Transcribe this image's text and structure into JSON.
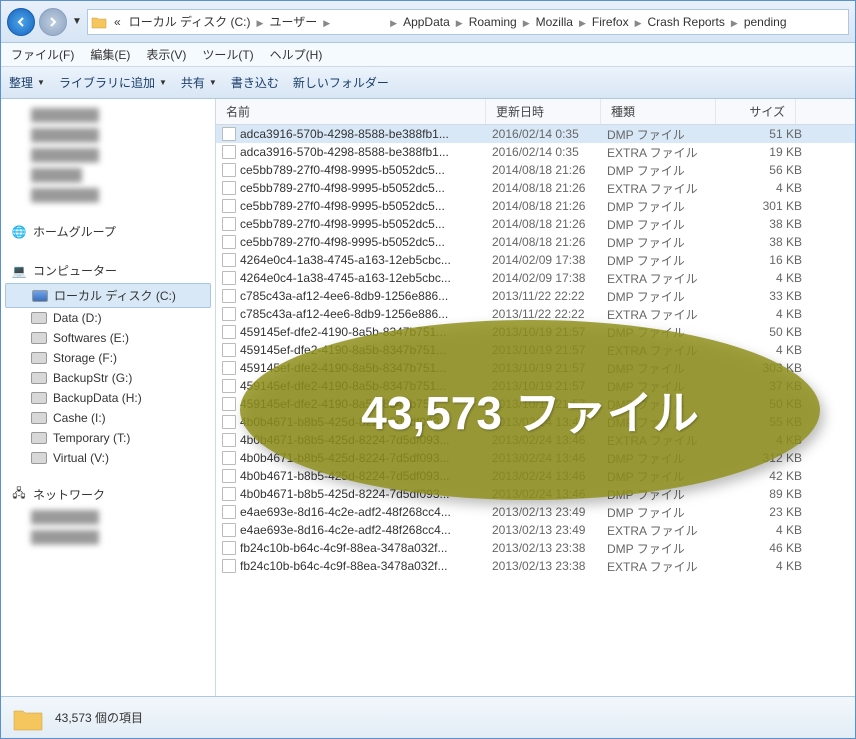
{
  "breadcrumb": {
    "prefix": "«",
    "segments": [
      "ローカル ディスク (C:)",
      "ユーザー",
      "　　　　",
      "AppData",
      "Roaming",
      "Mozilla",
      "Firefox",
      "Crash Reports",
      "pending"
    ]
  },
  "menubar": {
    "file": "ファイル(F)",
    "edit": "編集(E)",
    "view": "表示(V)",
    "tools": "ツール(T)",
    "help": "ヘルプ(H)"
  },
  "toolbar": {
    "organize": "整理",
    "library": "ライブラリに追加",
    "share": "共有",
    "burn": "書き込む",
    "newfolder": "新しいフォルダー"
  },
  "sidebar": {
    "homegroup": "ホームグループ",
    "computer": "コンピューター",
    "network": "ネットワーク",
    "drives": [
      {
        "label": "ローカル ディスク (C:)",
        "letter": "C",
        "selected": true
      },
      {
        "label": "Data (D:)",
        "letter": "D"
      },
      {
        "label": "Softwares (E:)",
        "letter": "E"
      },
      {
        "label": "Storage (F:)",
        "letter": "F"
      },
      {
        "label": "BackupStr (G:)",
        "letter": "G"
      },
      {
        "label": "BackupData (H:)",
        "letter": "H"
      },
      {
        "label": "Cashe (I:)",
        "letter": "I"
      },
      {
        "label": "Temporary (T:)",
        "letter": "T"
      },
      {
        "label": "Virtual (V:)",
        "letter": "V"
      }
    ]
  },
  "columns": {
    "name": "名前",
    "date": "更新日時",
    "type": "種類",
    "size": "サイズ"
  },
  "files": [
    {
      "name": "adca3916-570b-4298-8588-be388fb1...",
      "date": "2016/02/14 0:35",
      "type": "DMP ファイル",
      "size": "51 KB",
      "selected": true
    },
    {
      "name": "adca3916-570b-4298-8588-be388fb1...",
      "date": "2016/02/14 0:35",
      "type": "EXTRA ファイル",
      "size": "19 KB"
    },
    {
      "name": "ce5bb789-27f0-4f98-9995-b5052dc5...",
      "date": "2014/08/18 21:26",
      "type": "DMP ファイル",
      "size": "56 KB"
    },
    {
      "name": "ce5bb789-27f0-4f98-9995-b5052dc5...",
      "date": "2014/08/18 21:26",
      "type": "EXTRA ファイル",
      "size": "4 KB"
    },
    {
      "name": "ce5bb789-27f0-4f98-9995-b5052dc5...",
      "date": "2014/08/18 21:26",
      "type": "DMP ファイル",
      "size": "301 KB"
    },
    {
      "name": "ce5bb789-27f0-4f98-9995-b5052dc5...",
      "date": "2014/08/18 21:26",
      "type": "DMP ファイル",
      "size": "38 KB"
    },
    {
      "name": "ce5bb789-27f0-4f98-9995-b5052dc5...",
      "date": "2014/08/18 21:26",
      "type": "DMP ファイル",
      "size": "38 KB"
    },
    {
      "name": "4264e0c4-1a38-4745-a163-12eb5cbc...",
      "date": "2014/02/09 17:38",
      "type": "DMP ファイル",
      "size": "16 KB"
    },
    {
      "name": "4264e0c4-1a38-4745-a163-12eb5cbc...",
      "date": "2014/02/09 17:38",
      "type": "EXTRA ファイル",
      "size": "4 KB"
    },
    {
      "name": "c785c43a-af12-4ee6-8db9-1256e886...",
      "date": "2013/11/22 22:22",
      "type": "DMP ファイル",
      "size": "33 KB"
    },
    {
      "name": "c785c43a-af12-4ee6-8db9-1256e886...",
      "date": "2013/11/22 22:22",
      "type": "EXTRA ファイル",
      "size": "4 KB"
    },
    {
      "name": "459145ef-dfe2-4190-8a5b-8347b751...",
      "date": "2013/10/19 21:57",
      "type": "DMP ファイル",
      "size": "50 KB"
    },
    {
      "name": "459145ef-dfe2-4190-8a5b-8347b751...",
      "date": "2013/10/19 21:57",
      "type": "EXTRA ファイル",
      "size": "4 KB"
    },
    {
      "name": "459145ef-dfe2-4190-8a5b-8347b751...",
      "date": "2013/10/19 21:57",
      "type": "DMP ファイル",
      "size": "303 KB"
    },
    {
      "name": "459145ef-dfe2-4190-8a5b-8347b751...",
      "date": "2013/10/19 21:57",
      "type": "DMP ファイル",
      "size": "37 KB"
    },
    {
      "name": "459145ef-dfe2-4190-8a5b-8347b751...",
      "date": "2013/10/19 21:57",
      "type": "DMP ファイル",
      "size": "50 KB"
    },
    {
      "name": "4b0b4671-b8b5-425d-8224-7d5df093...",
      "date": "2013/02/24 13:46",
      "type": "DMP ファイル",
      "size": "55 KB"
    },
    {
      "name": "4b0b4671-b8b5-425d-8224-7d5df093...",
      "date": "2013/02/24 13:46",
      "type": "EXTRA ファイル",
      "size": "4 KB"
    },
    {
      "name": "4b0b4671-b8b5-425d-8224-7d5df093...",
      "date": "2013/02/24 13:46",
      "type": "DMP ファイル",
      "size": "312 KB"
    },
    {
      "name": "4b0b4671-b8b5-425d-8224-7d5df093...",
      "date": "2013/02/24 13:46",
      "type": "DMP ファイル",
      "size": "42 KB"
    },
    {
      "name": "4b0b4671-b8b5-425d-8224-7d5df093...",
      "date": "2013/02/24 13:46",
      "type": "DMP ファイル",
      "size": "89 KB"
    },
    {
      "name": "e4ae693e-8d16-4c2e-adf2-48f268cc4...",
      "date": "2013/02/13 23:49",
      "type": "DMP ファイル",
      "size": "23 KB"
    },
    {
      "name": "e4ae693e-8d16-4c2e-adf2-48f268cc4...",
      "date": "2013/02/13 23:49",
      "type": "EXTRA ファイル",
      "size": "4 KB"
    },
    {
      "name": "fb24c10b-b64c-4c9f-88ea-3478a032f...",
      "date": "2013/02/13 23:38",
      "type": "DMP ファイル",
      "size": "46 KB"
    },
    {
      "name": "fb24c10b-b64c-4c9f-88ea-3478a032f...",
      "date": "2013/02/13 23:38",
      "type": "EXTRA ファイル",
      "size": "4 KB"
    }
  ],
  "statusbar": {
    "count": "43,573 個の項目"
  },
  "overlay": {
    "text": "43,573 ファイル"
  }
}
